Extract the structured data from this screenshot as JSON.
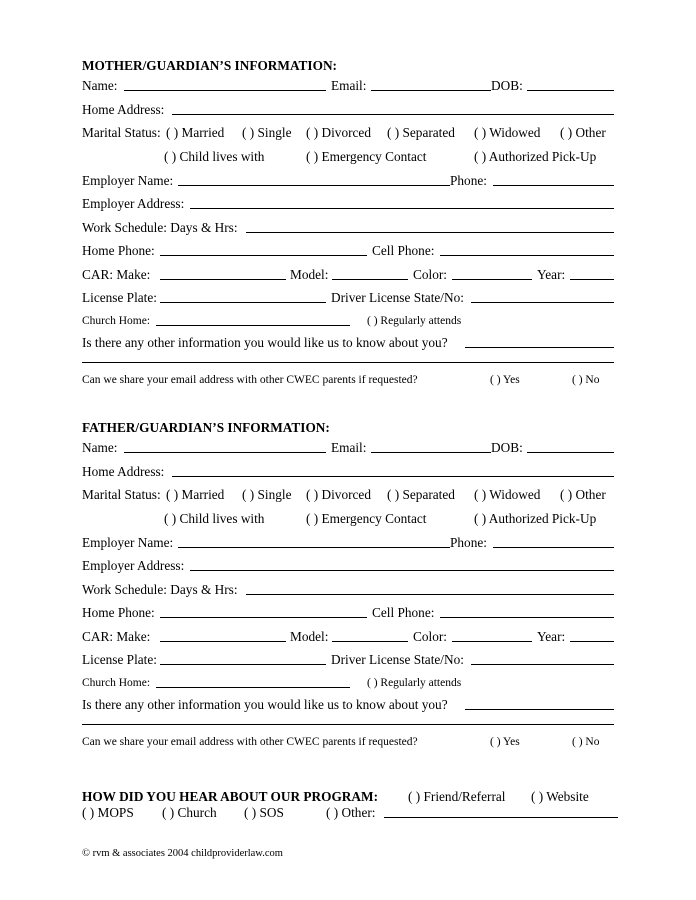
{
  "mother": {
    "heading": "MOTHER/GUARDIAN’S INFORMATION:",
    "name": "Name:",
    "email": "Email:",
    "dob": "DOB:",
    "home_address": "Home Address:",
    "marital_status": "Marital Status:",
    "options_row1": [
      "(   ) Married",
      "(   ) Single",
      "(   ) Divorced",
      "(   ) Separated",
      "(   ) Widowed",
      "(   ) Other"
    ],
    "options_row2": [
      "(   ) Child lives with",
      "(   ) Emergency Contact",
      "(   ) Authorized Pick-Up"
    ],
    "employer_name": "Employer Name:",
    "phone": "Phone:",
    "employer_address": "Employer Address:",
    "work_schedule": "Work Schedule: Days & Hrs:",
    "home_phone": "Home Phone:",
    "cell_phone": "Cell Phone:",
    "car_make": "CAR:   Make:",
    "model": "Model:",
    "color": "Color:",
    "year": "Year:",
    "license_plate": "License Plate:",
    "driver_license": "Driver License State/No:",
    "church_home": "Church Home:",
    "regularly_attends": "(   ) Regularly attends",
    "other_info": "Is there any other information you would like us to know about you?",
    "share_email": "Can we share your email address with other CWEC parents if requested?",
    "yes": "(   ) Yes",
    "no": "(   ) No"
  },
  "father": {
    "heading": "FATHER/GUARDIAN’S INFORMATION:",
    "name": "Name:",
    "email": "Email:",
    "dob": "DOB:",
    "home_address": "Home Address:",
    "marital_status": "Marital Status:",
    "options_row1": [
      "(   ) Married",
      "(   ) Single",
      "(   ) Divorced",
      "(   ) Separated",
      "(   ) Widowed",
      "(   ) Other"
    ],
    "options_row2": [
      "(   ) Child lives with",
      "(   ) Emergency Contact",
      "(   ) Authorized Pick-Up"
    ],
    "employer_name": "Employer Name:",
    "phone": "Phone:",
    "employer_address": "Employer Address:",
    "work_schedule": "Work Schedule: Days & Hrs:",
    "home_phone": "Home Phone:",
    "cell_phone": "Cell Phone:",
    "car_make": "CAR:   Make:",
    "model": "Model:",
    "color": "Color:",
    "year": "Year:",
    "license_plate": "License Plate:",
    "driver_license": "Driver License State/No:",
    "church_home": "Church Home:",
    "regularly_attends": "(   ) Regularly attends",
    "other_info": "Is there any other information you would like us to know about you?",
    "share_email": "Can we share your email address with other CWEC parents if requested?",
    "yes": "(   ) Yes",
    "no": "(   ) No"
  },
  "program": {
    "heading": "HOW DID YOU HEAR ABOUT OUR PROGRAM:",
    "friend": "(   ) Friend/Referral",
    "website": "(   ) Website",
    "mops": "(   ) MOPS",
    "church": "(   ) Church",
    "sos": "(   ) SOS",
    "other": "(   ) Other:"
  },
  "footer": "© rvm & associates 2004 childproviderlaw.com"
}
